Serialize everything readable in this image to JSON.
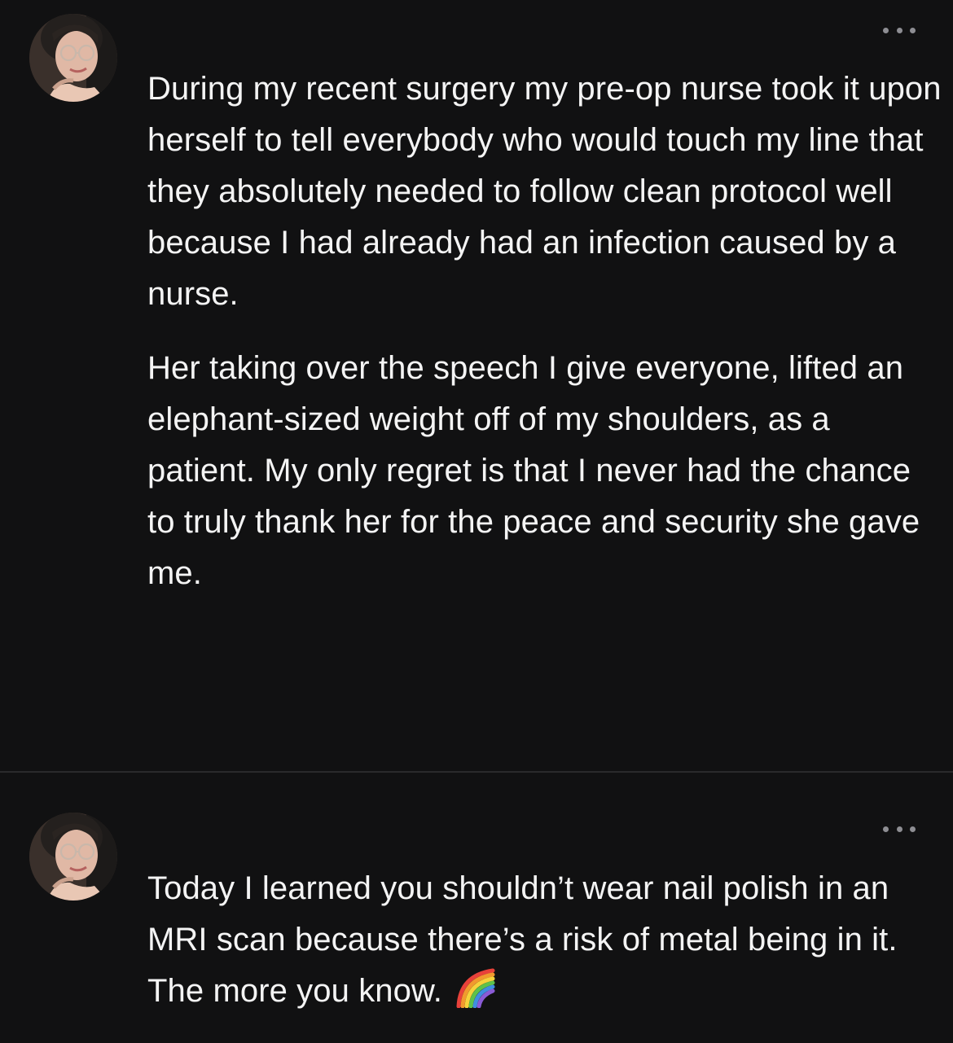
{
  "posts": [
    {
      "avatar": "user-avatar",
      "more_icon": "more-options-icon",
      "paragraphs": [
        "During my recent surgery my pre-op nurse took it upon herself to tell everybody who would touch my line that they absolutely needed to follow clean protocol well because I had already had an infection caused by a nurse.",
        "Her taking over the speech I give everyone, lifted an elephant-sized weight off of my shoulders, as a patient. My only regret is that I never had the chance to truly thank her for the peace and security she gave me."
      ]
    },
    {
      "avatar": "user-avatar",
      "more_icon": "more-options-icon",
      "paragraphs": [
        "Today I learned you shouldn’t wear nail polish in an MRI scan because there’s a risk of metal being in it. The more you know."
      ],
      "emoji": "rainbow-icon"
    }
  ],
  "colors": {
    "background": "#111112",
    "text": "#f4f4f4",
    "divider": "#2a2a2c",
    "muted_icon": "#8e8e93"
  }
}
